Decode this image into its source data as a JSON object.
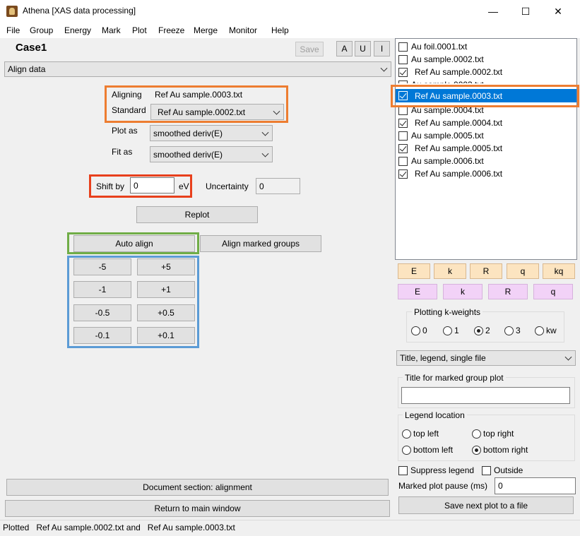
{
  "window": {
    "title": "Athena [XAS data processing]",
    "minimize": "—",
    "maximize": "☐",
    "close": "✕"
  },
  "menu": [
    "File",
    "Group",
    "Energy",
    "Mark",
    "Plot",
    "Freeze",
    "Merge",
    "Monitor",
    "Help"
  ],
  "header": {
    "project": "Case1",
    "save": "Save",
    "a": "A",
    "u": "U",
    "i": "I"
  },
  "tool_select": "Align data",
  "align": {
    "aligning_label": "Aligning",
    "aligning_value": "Ref Au sample.0003.txt",
    "standard_label": "Standard",
    "standard_value": "Ref Au sample.0002.txt",
    "plot_as_label": "Plot as",
    "plot_as_value": "smoothed deriv(E)",
    "fit_as_label": "Fit as",
    "fit_as_value": "smoothed deriv(E)",
    "shift_label": "Shift by",
    "shift_value": "0",
    "shift_unit": "eV",
    "uncertainty_label": "Uncertainty",
    "uncertainty_value": "0",
    "replot": "Replot",
    "auto_align": "Auto align",
    "align_marked": "Align marked groups",
    "steps": [
      "-5",
      "+5",
      "-1",
      "+1",
      "-0.5",
      "+0.5",
      "-0.1",
      "+0.1"
    ]
  },
  "bottom_buttons": {
    "doc": "Document section: alignment",
    "return": "Return to main window"
  },
  "status": "Plotted   Ref Au sample.0002.txt and   Ref Au sample.0003.txt",
  "groups": [
    {
      "label": "Au foil.0001.txt",
      "checked": false,
      "selected": false
    },
    {
      "label": "Au sample.0002.txt",
      "checked": false,
      "selected": false
    },
    {
      "label": "Ref Au sample.0002.txt",
      "checked": true,
      "selected": false
    },
    {
      "label": "Au sample.0003.txt",
      "checked": false,
      "selected": false
    },
    {
      "label": "Ref Au sample.0003.txt",
      "checked": true,
      "selected": true
    },
    {
      "label": "Au sample.0004.txt",
      "checked": false,
      "selected": false
    },
    {
      "label": "Ref Au sample.0004.txt",
      "checked": true,
      "selected": false
    },
    {
      "label": "Au sample.0005.txt",
      "checked": false,
      "selected": false
    },
    {
      "label": "Ref Au sample.0005.txt",
      "checked": true,
      "selected": false
    },
    {
      "label": "Au sample.0006.txt",
      "checked": false,
      "selected": false
    },
    {
      "label": "Ref Au sample.0006.txt",
      "checked": true,
      "selected": false
    }
  ],
  "plot_single": [
    "E",
    "k",
    "R",
    "q",
    "kq"
  ],
  "plot_marked": [
    "E",
    "k",
    "R",
    "q"
  ],
  "kweights": {
    "title": "Plotting k-weights",
    "options": [
      "0",
      "1",
      "2",
      "3",
      "kw"
    ],
    "selected": "2"
  },
  "plot_options_select": "Title, legend, single file",
  "marked_title": {
    "label": "Title for marked group plot",
    "value": ""
  },
  "legend": {
    "title": "Legend location",
    "options": [
      "top left",
      "top right",
      "bottom left",
      "bottom right"
    ],
    "selected": "bottom right"
  },
  "suppress_legend": "Suppress legend",
  "outside": "Outside",
  "pause": {
    "label": "Marked plot pause (ms)",
    "value": "0"
  },
  "save_next": "Save next plot to a file"
}
